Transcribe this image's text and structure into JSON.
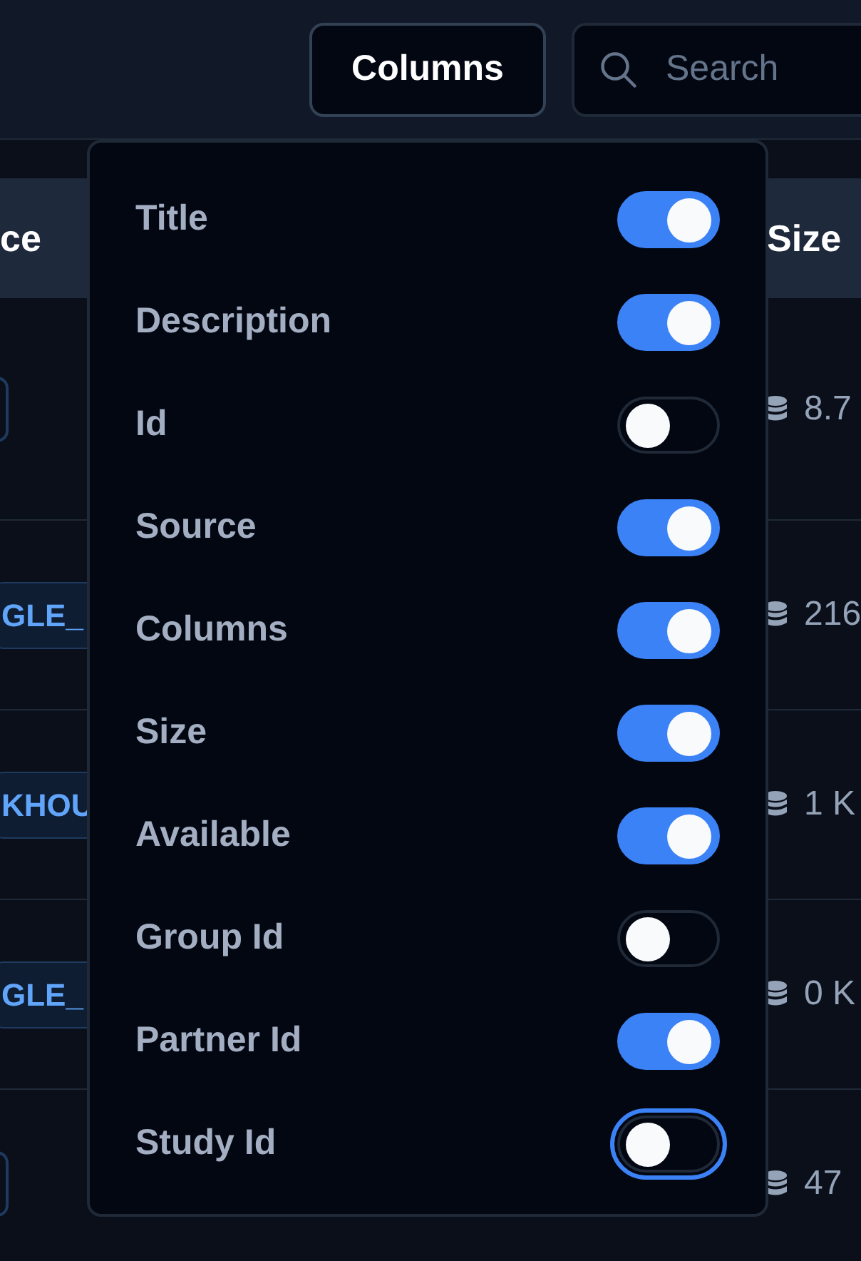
{
  "toolbar": {
    "columns_button": "Columns",
    "search": {
      "placeholder": "Search"
    }
  },
  "table": {
    "headers": {
      "column_1": "ce",
      "column_2": "Size"
    },
    "rows": [
      {
        "size": "8.7"
      },
      {
        "source": "GLE_",
        "size": "216"
      },
      {
        "source": "KHOU",
        "size": "1 K"
      },
      {
        "source": "GLE_",
        "size": "0 K"
      },
      {
        "size": "47"
      }
    ]
  },
  "column_menu": {
    "items": [
      {
        "label": "Title",
        "on": true,
        "focused": false
      },
      {
        "label": "Description",
        "on": true,
        "focused": false
      },
      {
        "label": "Id",
        "on": false,
        "focused": false
      },
      {
        "label": "Source",
        "on": true,
        "focused": false
      },
      {
        "label": "Columns",
        "on": true,
        "focused": false
      },
      {
        "label": "Size",
        "on": true,
        "focused": false
      },
      {
        "label": "Available",
        "on": true,
        "focused": false
      },
      {
        "label": "Group Id",
        "on": false,
        "focused": false
      },
      {
        "label": "Partner Id",
        "on": true,
        "focused": false
      },
      {
        "label": "Study Id",
        "on": false,
        "focused": true
      }
    ]
  }
}
